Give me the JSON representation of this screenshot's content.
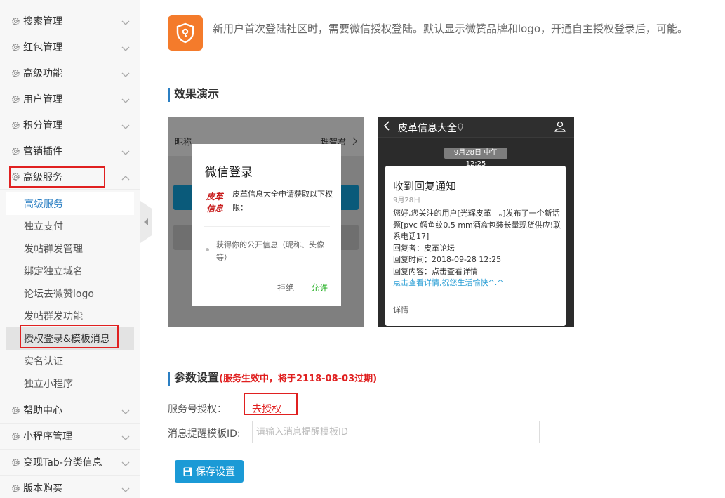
{
  "sidebar": {
    "groups_top": [
      {
        "label": "搜索管理"
      },
      {
        "label": "红包管理"
      },
      {
        "label": "高级功能"
      },
      {
        "label": "用户管理"
      },
      {
        "label": "积分管理"
      },
      {
        "label": "营销插件"
      }
    ],
    "expanded_group": {
      "label": "高级服务"
    },
    "sub_items": [
      {
        "label": "高级服务"
      },
      {
        "label": "独立支付"
      },
      {
        "label": "发帖群发管理"
      },
      {
        "label": "绑定独立域名"
      },
      {
        "label": "论坛去微赞logo"
      },
      {
        "label": "发帖群发功能"
      },
      {
        "label": "授权登录&模板消息"
      },
      {
        "label": "实名认证"
      },
      {
        "label": "独立小程序"
      }
    ],
    "groups_bottom": [
      {
        "label": "帮助中心"
      },
      {
        "label": "小程序管理"
      },
      {
        "label": "变现Tab-分类信息"
      },
      {
        "label": "版本购买"
      }
    ]
  },
  "intro": {
    "text": "新用户首次登陆社区时，需要微信授权登陆。默认显示微赞品牌和logo，开通自主授权登录后，可能。"
  },
  "demo": {
    "title": "效果演示",
    "phone1": {
      "nickname": "昵称",
      "right_text": "理智君",
      "dialog_title": "微信登录",
      "request_text": "皮革信息大全申请获取以下权限：",
      "logo_text": "皮革信息",
      "permission": "获得你的公开信息（昵称、头像等）",
      "deny": "拒绝",
      "allow": "允许"
    },
    "phone2": {
      "header_title": "皮革信息大全",
      "timestamp": "9月28日 中午12:25",
      "card_title": "收到回复通知",
      "card_date": "9月28日",
      "body_lines": [
        "您好,您关注的用户[光辉皮革　。]发布了一个新话题[pvc 鳄鱼纹0.5 mm酒盒包装长量现货供应!联系电话17]",
        "回复者：皮革论坛",
        "回复时间：2018-09-28 12:25",
        "回复内容：点击查看详情"
      ],
      "link_text": "点击查看详情,祝您生活愉快^.^",
      "detail": "详情"
    }
  },
  "params": {
    "title": "参数设置",
    "notice": "(服务生效中，将于2118-08-03过期)",
    "service_label": "服务号授权：",
    "service_action": "去授权",
    "template_label": "消息提醒模板ID:",
    "template_placeholder": "请输入消息提醒模板ID",
    "template_value": "",
    "save_label": "保存设置"
  },
  "colors": {
    "accent": "#2b7fc3",
    "highlight_box": "#e02020",
    "save_button": "#1b9ad6",
    "intro_icon": "#f47b2b",
    "allow_green": "#1aad19"
  },
  "icons": {
    "menu": "gear-icon",
    "expand": "chevron-down-icon",
    "collapse": "chevron-up-icon",
    "intro": "shield-key-icon",
    "save": "floppy-disk-icon"
  }
}
